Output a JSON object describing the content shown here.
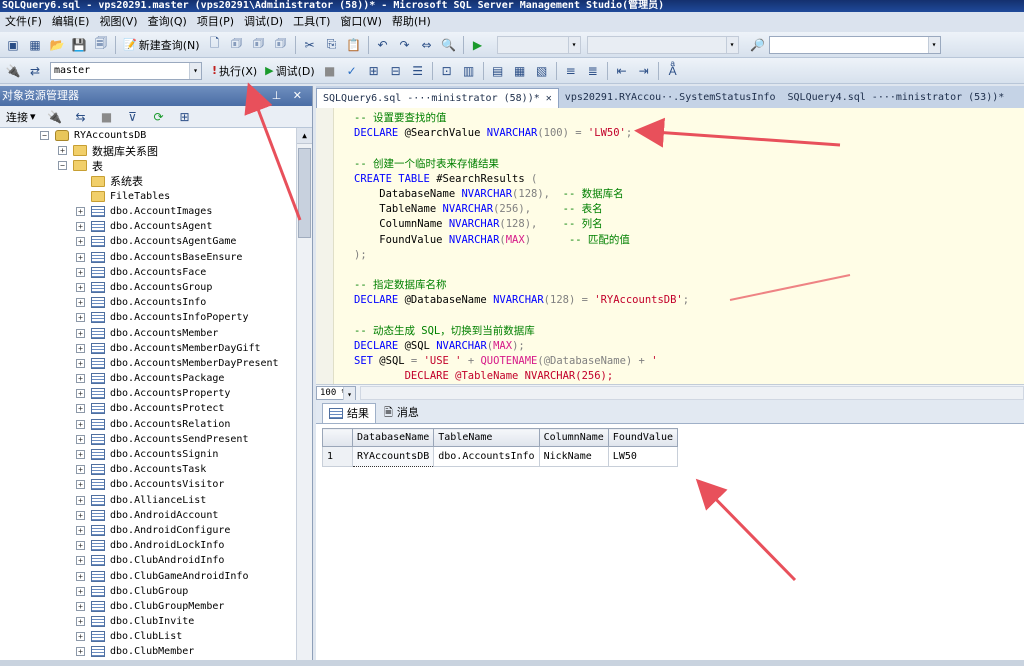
{
  "window": {
    "title": "SQLQuery6.sql - vps20291.master (vps20291\\Administrator (58))* - Microsoft SQL Server Management Studio(管理员)"
  },
  "menu": [
    "文件(F)",
    "编辑(E)",
    "视图(V)",
    "查询(Q)",
    "项目(P)",
    "调试(D)",
    "工具(T)",
    "窗口(W)",
    "帮助(H)"
  ],
  "toolbar1": {
    "new_query_label": "新建查询(N)"
  },
  "toolbar2": {
    "database_selector": "master",
    "execute_label": "执行(X)",
    "debug_label": "调试(D)"
  },
  "object_explorer": {
    "title": "对象资源管理器",
    "connect_label": "连接",
    "tree": [
      {
        "label": "RYAccountsDB",
        "level": 0,
        "icon": "database-icon",
        "expander": "−"
      },
      {
        "label": "数据库关系图",
        "level": 1,
        "icon": "folder-icon",
        "expander": "+"
      },
      {
        "label": "表",
        "level": 1,
        "icon": "folder-icon",
        "expander": "−"
      },
      {
        "label": "系统表",
        "level": 2,
        "icon": "folder-icon",
        "expander": ""
      },
      {
        "label": "FileTables",
        "level": 2,
        "icon": "folder-icon",
        "expander": ""
      },
      {
        "label": "dbo.AccountImages",
        "level": 2,
        "icon": "table-icon",
        "expander": "+"
      },
      {
        "label": "dbo.AccountsAgent",
        "level": 2,
        "icon": "table-icon",
        "expander": "+"
      },
      {
        "label": "dbo.AccountsAgentGame",
        "level": 2,
        "icon": "table-icon",
        "expander": "+"
      },
      {
        "label": "dbo.AccountsBaseEnsure",
        "level": 2,
        "icon": "table-icon",
        "expander": "+"
      },
      {
        "label": "dbo.AccountsFace",
        "level": 2,
        "icon": "table-icon",
        "expander": "+"
      },
      {
        "label": "dbo.AccountsGroup",
        "level": 2,
        "icon": "table-icon",
        "expander": "+"
      },
      {
        "label": "dbo.AccountsInfo",
        "level": 2,
        "icon": "table-icon",
        "expander": "+"
      },
      {
        "label": "dbo.AccountsInfoPoperty",
        "level": 2,
        "icon": "table-icon",
        "expander": "+"
      },
      {
        "label": "dbo.AccountsMember",
        "level": 2,
        "icon": "table-icon",
        "expander": "+"
      },
      {
        "label": "dbo.AccountsMemberDayGift",
        "level": 2,
        "icon": "table-icon",
        "expander": "+"
      },
      {
        "label": "dbo.AccountsMemberDayPresent",
        "level": 2,
        "icon": "table-icon",
        "expander": "+"
      },
      {
        "label": "dbo.AccountsPackage",
        "level": 2,
        "icon": "table-icon",
        "expander": "+"
      },
      {
        "label": "dbo.AccountsProperty",
        "level": 2,
        "icon": "table-icon",
        "expander": "+"
      },
      {
        "label": "dbo.AccountsProtect",
        "level": 2,
        "icon": "table-icon",
        "expander": "+"
      },
      {
        "label": "dbo.AccountsRelation",
        "level": 2,
        "icon": "table-icon",
        "expander": "+"
      },
      {
        "label": "dbo.AccountsSendPresent",
        "level": 2,
        "icon": "table-icon",
        "expander": "+"
      },
      {
        "label": "dbo.AccountsSignin",
        "level": 2,
        "icon": "table-icon",
        "expander": "+"
      },
      {
        "label": "dbo.AccountsTask",
        "level": 2,
        "icon": "table-icon",
        "expander": "+"
      },
      {
        "label": "dbo.AccountsVisitor",
        "level": 2,
        "icon": "table-icon",
        "expander": "+"
      },
      {
        "label": "dbo.AllianceList",
        "level": 2,
        "icon": "table-icon",
        "expander": "+"
      },
      {
        "label": "dbo.AndroidAccount",
        "level": 2,
        "icon": "table-icon",
        "expander": "+"
      },
      {
        "label": "dbo.AndroidConfigure",
        "level": 2,
        "icon": "table-icon",
        "expander": "+"
      },
      {
        "label": "dbo.AndroidLockInfo",
        "level": 2,
        "icon": "table-icon",
        "expander": "+"
      },
      {
        "label": "dbo.ClubAndroidInfo",
        "level": 2,
        "icon": "table-icon",
        "expander": "+"
      },
      {
        "label": "dbo.ClubGameAndroidInfo",
        "level": 2,
        "icon": "table-icon",
        "expander": "+"
      },
      {
        "label": "dbo.ClubGroup",
        "level": 2,
        "icon": "table-icon",
        "expander": "+"
      },
      {
        "label": "dbo.ClubGroupMember",
        "level": 2,
        "icon": "table-icon",
        "expander": "+"
      },
      {
        "label": "dbo.ClubInvite",
        "level": 2,
        "icon": "table-icon",
        "expander": "+"
      },
      {
        "label": "dbo.ClubList",
        "level": 2,
        "icon": "table-icon",
        "expander": "+"
      },
      {
        "label": "dbo.ClubMember",
        "level": 2,
        "icon": "table-icon",
        "expander": "+"
      }
    ]
  },
  "tabs": [
    {
      "label": "SQLQuery6.sql -···ministrator (58))*",
      "active": true,
      "closable": true
    },
    {
      "label": "vps20291.RYAccou··.SystemStatusInfo",
      "active": false,
      "closable": false
    },
    {
      "label": "SQLQuery4.sql -···ministrator (53))*",
      "active": false,
      "closable": false
    }
  ],
  "editor": {
    "lines": [
      [
        {
          "t": "-- 设置要查找的值",
          "c": "cm"
        }
      ],
      [
        {
          "t": "DECLARE ",
          "c": "kw"
        },
        {
          "t": "@SearchValue ",
          "c": ""
        },
        {
          "t": "NVARCHAR",
          "c": "kw"
        },
        {
          "t": "(100) = ",
          "c": "gy"
        },
        {
          "t": "'LW50'",
          "c": "st"
        },
        {
          "t": ";",
          "c": "gy"
        }
      ],
      [
        {
          "t": "",
          "c": ""
        }
      ],
      [
        {
          "t": "-- 创建一个临时表来存储结果",
          "c": "cm"
        }
      ],
      [
        {
          "t": "CREATE TABLE ",
          "c": "kw"
        },
        {
          "t": "#SearchResults ",
          "c": ""
        },
        {
          "t": "(",
          "c": "gy"
        }
      ],
      [
        {
          "t": "    DatabaseName ",
          "c": ""
        },
        {
          "t": "NVARCHAR",
          "c": "kw"
        },
        {
          "t": "(128),  ",
          "c": "gy"
        },
        {
          "t": "-- 数据库名",
          "c": "cm"
        }
      ],
      [
        {
          "t": "    TableName ",
          "c": ""
        },
        {
          "t": "NVARCHAR",
          "c": "kw"
        },
        {
          "t": "(256),     ",
          "c": "gy"
        },
        {
          "t": "-- 表名",
          "c": "cm"
        }
      ],
      [
        {
          "t": "    ColumnName ",
          "c": ""
        },
        {
          "t": "NVARCHAR",
          "c": "kw"
        },
        {
          "t": "(128),    ",
          "c": "gy"
        },
        {
          "t": "-- 列名",
          "c": "cm"
        }
      ],
      [
        {
          "t": "    FoundValue ",
          "c": ""
        },
        {
          "t": "NVARCHAR",
          "c": "kw"
        },
        {
          "t": "(",
          "c": "gy"
        },
        {
          "t": "MAX",
          "c": "fn"
        },
        {
          "t": ")      ",
          "c": "gy"
        },
        {
          "t": "-- 匹配的值",
          "c": "cm"
        }
      ],
      [
        {
          "t": ");",
          "c": "gy"
        }
      ],
      [
        {
          "t": "",
          "c": ""
        }
      ],
      [
        {
          "t": "-- 指定数据库名称",
          "c": "cm"
        }
      ],
      [
        {
          "t": "DECLARE ",
          "c": "kw"
        },
        {
          "t": "@DatabaseName ",
          "c": ""
        },
        {
          "t": "NVARCHAR",
          "c": "kw"
        },
        {
          "t": "(128) = ",
          "c": "gy"
        },
        {
          "t": "'RYAccountsDB'",
          "c": "st"
        },
        {
          "t": ";",
          "c": "gy"
        }
      ],
      [
        {
          "t": "",
          "c": ""
        }
      ],
      [
        {
          "t": "-- 动态生成 SQL，切换到当前数据库",
          "c": "cm"
        }
      ],
      [
        {
          "t": "DECLARE ",
          "c": "kw"
        },
        {
          "t": "@SQL ",
          "c": ""
        },
        {
          "t": "NVARCHAR",
          "c": "kw"
        },
        {
          "t": "(",
          "c": "gy"
        },
        {
          "t": "MAX",
          "c": "fn"
        },
        {
          "t": ");",
          "c": "gy"
        }
      ],
      [
        {
          "t": "SET ",
          "c": "kw"
        },
        {
          "t": "@SQL ",
          "c": ""
        },
        {
          "t": "= ",
          "c": "gy"
        },
        {
          "t": "'USE ' ",
          "c": "st"
        },
        {
          "t": "+ ",
          "c": "gy"
        },
        {
          "t": "QUOTENAME",
          "c": "fn"
        },
        {
          "t": "(@DatabaseName) + ",
          "c": "gy"
        },
        {
          "t": "'",
          "c": "st"
        }
      ],
      [
        {
          "t": "        DECLARE @TableName NVARCHAR(256);",
          "c": "st"
        }
      ]
    ]
  },
  "zoom": "100 %",
  "results": {
    "tab_results": "结果",
    "tab_messages": "消息",
    "columns": [
      "DatabaseName",
      "TableName",
      "ColumnName",
      "FoundValue"
    ],
    "rows": [
      {
        "num": "1",
        "cells": [
          "RYAccountsDB",
          "dbo.AccountsInfo",
          "NickName",
          "LW50"
        ]
      }
    ]
  },
  "colors": {
    "annotation_arrow": "#e8505b",
    "keyword": "#0000ff",
    "comment": "#008000",
    "string": "#c2002a"
  }
}
